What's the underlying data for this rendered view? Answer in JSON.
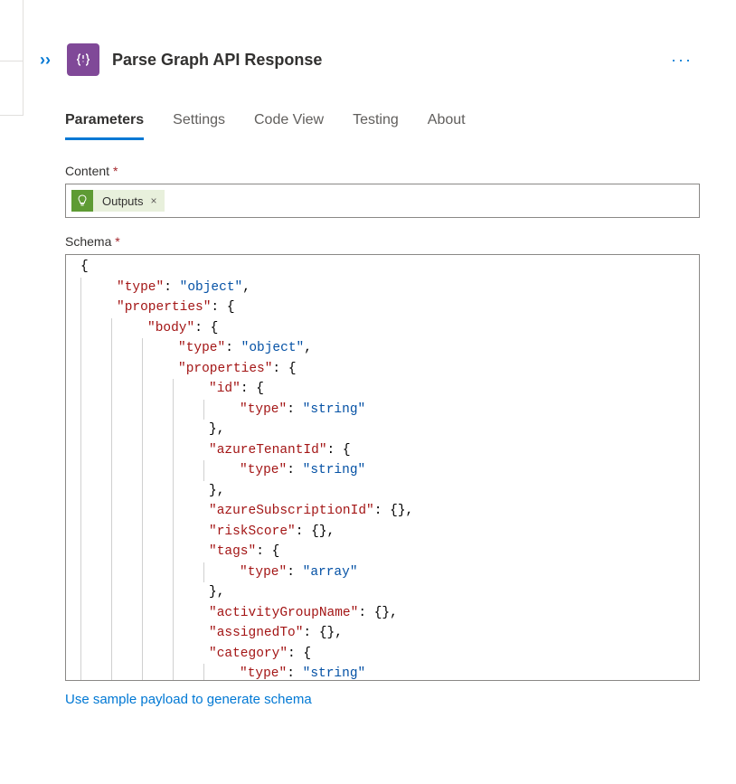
{
  "header": {
    "title": "Parse Graph API Response"
  },
  "tabs": [
    {
      "label": "Parameters",
      "active": true
    },
    {
      "label": "Settings",
      "active": false
    },
    {
      "label": "Code View",
      "active": false
    },
    {
      "label": "Testing",
      "active": false
    },
    {
      "label": "About",
      "active": false
    }
  ],
  "fields": {
    "content": {
      "label": "Content",
      "required_marker": "*",
      "token": {
        "label": "Outputs"
      }
    },
    "schema": {
      "label": "Schema",
      "required_marker": "*"
    }
  },
  "schema_lines": [
    {
      "indent": 0,
      "tokens": [
        {
          "t": "p",
          "v": "{"
        }
      ]
    },
    {
      "indent": 1,
      "tokens": [
        {
          "t": "k",
          "v": "\"type\""
        },
        {
          "t": "p",
          "v": ": "
        },
        {
          "t": "s",
          "v": "\"object\""
        },
        {
          "t": "p",
          "v": ","
        }
      ]
    },
    {
      "indent": 1,
      "tokens": [
        {
          "t": "k",
          "v": "\"properties\""
        },
        {
          "t": "p",
          "v": ": {"
        }
      ]
    },
    {
      "indent": 2,
      "tokens": [
        {
          "t": "k",
          "v": "\"body\""
        },
        {
          "t": "p",
          "v": ": {"
        }
      ]
    },
    {
      "indent": 3,
      "tokens": [
        {
          "t": "k",
          "v": "\"type\""
        },
        {
          "t": "p",
          "v": ": "
        },
        {
          "t": "s",
          "v": "\"object\""
        },
        {
          "t": "p",
          "v": ","
        }
      ]
    },
    {
      "indent": 3,
      "tokens": [
        {
          "t": "k",
          "v": "\"properties\""
        },
        {
          "t": "p",
          "v": ": {"
        }
      ]
    },
    {
      "indent": 4,
      "tokens": [
        {
          "t": "k",
          "v": "\"id\""
        },
        {
          "t": "p",
          "v": ": {"
        }
      ]
    },
    {
      "indent": 5,
      "tokens": [
        {
          "t": "k",
          "v": "\"type\""
        },
        {
          "t": "p",
          "v": ": "
        },
        {
          "t": "s",
          "v": "\"string\""
        }
      ]
    },
    {
      "indent": 4,
      "tokens": [
        {
          "t": "p",
          "v": "},"
        }
      ]
    },
    {
      "indent": 4,
      "tokens": [
        {
          "t": "k",
          "v": "\"azureTenantId\""
        },
        {
          "t": "p",
          "v": ": {"
        }
      ]
    },
    {
      "indent": 5,
      "tokens": [
        {
          "t": "k",
          "v": "\"type\""
        },
        {
          "t": "p",
          "v": ": "
        },
        {
          "t": "s",
          "v": "\"string\""
        }
      ]
    },
    {
      "indent": 4,
      "tokens": [
        {
          "t": "p",
          "v": "},"
        }
      ]
    },
    {
      "indent": 4,
      "tokens": [
        {
          "t": "k",
          "v": "\"azureSubscriptionId\""
        },
        {
          "t": "p",
          "v": ": {},"
        }
      ]
    },
    {
      "indent": 4,
      "tokens": [
        {
          "t": "k",
          "v": "\"riskScore\""
        },
        {
          "t": "p",
          "v": ": {},"
        }
      ]
    },
    {
      "indent": 4,
      "tokens": [
        {
          "t": "k",
          "v": "\"tags\""
        },
        {
          "t": "p",
          "v": ": {"
        }
      ]
    },
    {
      "indent": 5,
      "tokens": [
        {
          "t": "k",
          "v": "\"type\""
        },
        {
          "t": "p",
          "v": ": "
        },
        {
          "t": "s",
          "v": "\"array\""
        }
      ]
    },
    {
      "indent": 4,
      "tokens": [
        {
          "t": "p",
          "v": "},"
        }
      ]
    },
    {
      "indent": 4,
      "tokens": [
        {
          "t": "k",
          "v": "\"activityGroupName\""
        },
        {
          "t": "p",
          "v": ": {},"
        }
      ]
    },
    {
      "indent": 4,
      "tokens": [
        {
          "t": "k",
          "v": "\"assignedTo\""
        },
        {
          "t": "p",
          "v": ": {},"
        }
      ]
    },
    {
      "indent": 4,
      "tokens": [
        {
          "t": "k",
          "v": "\"category\""
        },
        {
          "t": "p",
          "v": ": {"
        }
      ]
    },
    {
      "indent": 5,
      "tokens": [
        {
          "t": "k",
          "v": "\"type\""
        },
        {
          "t": "p",
          "v": ": "
        },
        {
          "t": "s",
          "v": "\"string\""
        }
      ]
    }
  ],
  "footer_link": "Use sample payload to generate schema"
}
